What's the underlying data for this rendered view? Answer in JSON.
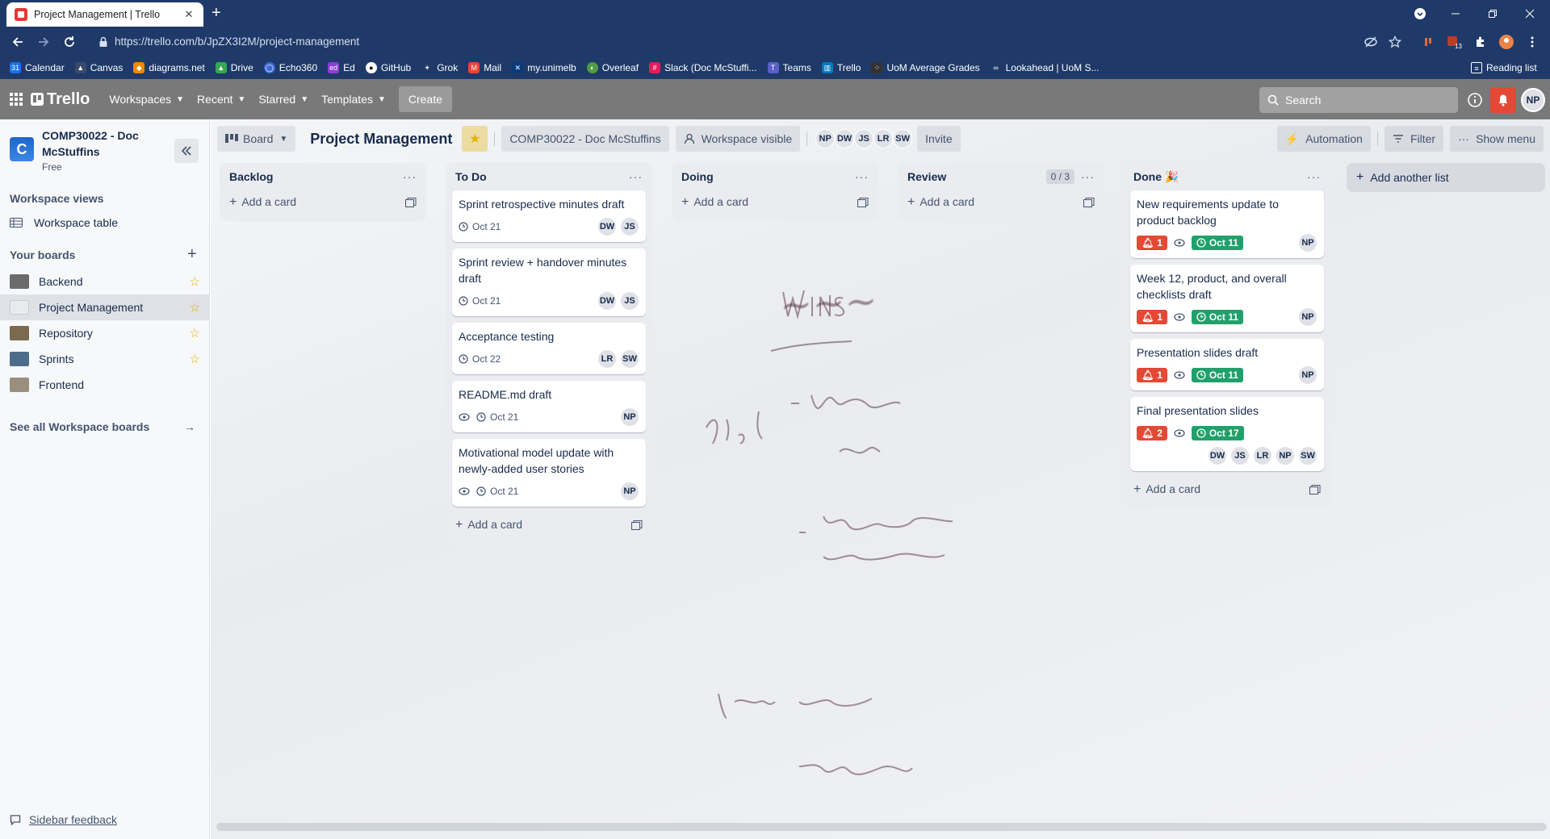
{
  "browser": {
    "tab_title": "Project Management | Trello",
    "url": "https://trello.com/b/JpZX3I2M/project-management",
    "bookmarks": [
      "Calendar",
      "Canvas",
      "diagrams.net",
      "Drive",
      "Echo360",
      "Ed",
      "GitHub",
      "Grok",
      "Mail",
      "my.unimelb",
      "Overleaf",
      "Slack (Doc McStuffi...",
      "Teams",
      "Trello",
      "UoM Average Grades",
      "Lookahead | UoM S..."
    ],
    "reading_list": "Reading list",
    "ext_badge": "13"
  },
  "header": {
    "logo": "Trello",
    "menus": [
      "Workspaces",
      "Recent",
      "Starred",
      "Templates"
    ],
    "create": "Create",
    "search_placeholder": "Search",
    "user_initials": "NP"
  },
  "sidebar": {
    "workspace_initial": "C",
    "workspace_name": "COMP30022 - Doc McStuffins",
    "workspace_plan": "Free",
    "views_heading": "Workspace views",
    "workspace_table": "Workspace table",
    "boards_heading": "Your boards",
    "boards": [
      {
        "name": "Backend",
        "starred": true,
        "color": "#6b6b6b"
      },
      {
        "name": "Project Management",
        "starred": true,
        "color": "#e8eaee",
        "active": true
      },
      {
        "name": "Repository",
        "starred": true,
        "color": "#7a6a50"
      },
      {
        "name": "Sprints",
        "starred": true,
        "color": "#4b6d8a"
      },
      {
        "name": "Frontend",
        "starred": false,
        "color": "#9a8f7e"
      }
    ],
    "see_all": "See all Workspace boards",
    "feedback": "Sidebar feedback"
  },
  "boardbar": {
    "view": "Board",
    "title": "Project Management",
    "workspace": "COMP30022 - Doc McStuffins",
    "visibility": "Workspace visible",
    "members": [
      "NP",
      "DW",
      "JS",
      "LR",
      "SW"
    ],
    "invite": "Invite",
    "automation": "Automation",
    "filter": "Filter",
    "show_menu": "Show menu"
  },
  "lists": [
    {
      "title": "Backlog",
      "count": "",
      "cards": [],
      "add": "Add a card"
    },
    {
      "title": "To Do",
      "count": "",
      "add": "Add a card",
      "cards": [
        {
          "title": "Sprint retrospective minutes draft",
          "due": "Oct 21",
          "watch": false,
          "members": [
            "DW",
            "JS"
          ]
        },
        {
          "title": "Sprint review + handover minutes draft",
          "due": "Oct 21",
          "watch": false,
          "members": [
            "DW",
            "JS"
          ]
        },
        {
          "title": "Acceptance testing",
          "due": "Oct 22",
          "watch": false,
          "members": [
            "LR",
            "SW"
          ]
        },
        {
          "title": "README.md draft",
          "due": "Oct 21",
          "watch": true,
          "members": [
            "NP"
          ]
        },
        {
          "title": "Motivational model update with newly-added user stories",
          "due": "Oct 21",
          "watch": true,
          "members": [
            "NP"
          ]
        }
      ]
    },
    {
      "title": "Doing",
      "count": "",
      "cards": [],
      "add": "Add a card"
    },
    {
      "title": "Review",
      "count": "0 / 3",
      "cards": [],
      "add": "Add a card"
    },
    {
      "title": "Done 🎉",
      "count": "",
      "add": "Add a card",
      "cards": [
        {
          "title": "New requirements update to product backlog",
          "notif": "1",
          "due": "Oct 11",
          "members": [
            "NP"
          ]
        },
        {
          "title": "Week 12, product, and overall checklists draft",
          "notif": "1",
          "due": "Oct 11",
          "members": [
            "NP"
          ]
        },
        {
          "title": "Presentation slides draft",
          "notif": "1",
          "due": "Oct 11",
          "members": [
            "NP"
          ]
        },
        {
          "title": "Final presentation slides",
          "notif": "2",
          "due": "Oct 17",
          "members": [
            "DW",
            "JS",
            "LR",
            "NP",
            "SW"
          ]
        }
      ]
    }
  ],
  "add_list": "Add another list",
  "colors": {
    "chrome": "#1f3a68",
    "header": "#79797a",
    "due_done": "#22a06b",
    "notif": "#e34935"
  }
}
